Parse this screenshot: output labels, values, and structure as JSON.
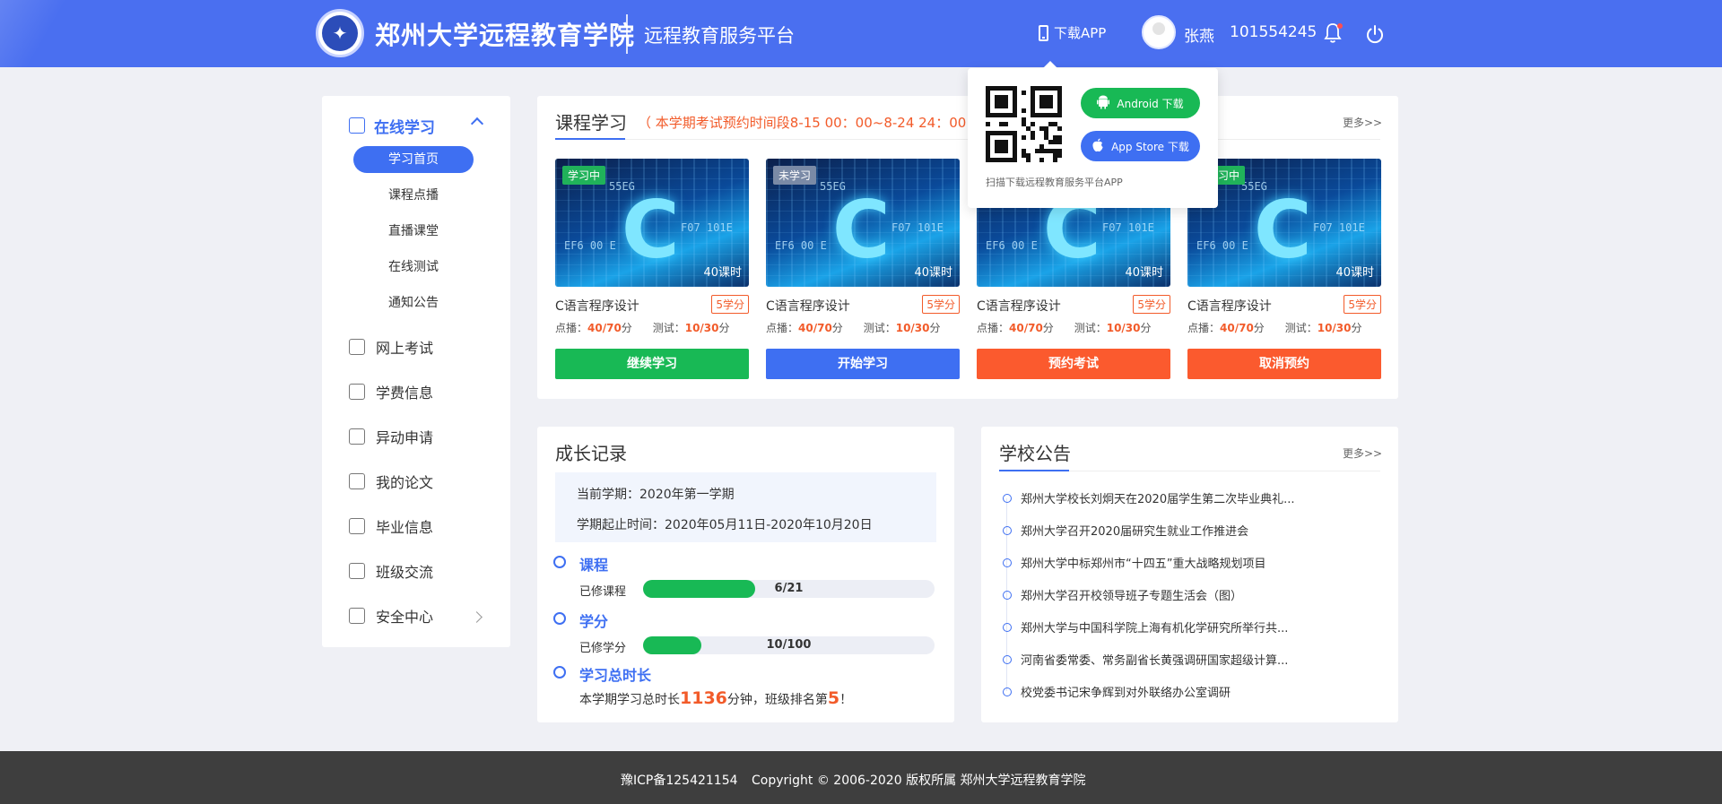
{
  "header": {
    "brand": "郑州大学远程教育学院",
    "platform": "远程教育服务平台",
    "download_app": "下载APP",
    "user_name": "张燕",
    "user_id": "101554245",
    "colors": {
      "header_bg": "#4a6ff0",
      "accent": "#3e6ff2",
      "green": "#18b955",
      "orange": "#fb5a2e",
      "red_text": "#f25b2a"
    }
  },
  "sidebar": {
    "section": "在线学习",
    "subitems": [
      "学习首页",
      "课程点播",
      "直播课堂",
      "在线测试",
      "通知公告"
    ],
    "items": [
      "网上考试",
      "学费信息",
      "异动申请",
      "我的论文",
      "毕业信息",
      "班级交流",
      "安全中心"
    ]
  },
  "course": {
    "title": "课程学习",
    "exam_notice": "（ 本学期考试预约时间段8-15 00：00~8-24 24：00 ）",
    "more": "更多>>",
    "cards": [
      {
        "badge": "学习中",
        "hours": "40课时",
        "name": "C语言程序设计",
        "credit": "5学分",
        "play_label": "点播：",
        "play": "40/70",
        "test_label": "测试：",
        "test": "10/30",
        "unit": "分",
        "button": "继续学习"
      },
      {
        "badge": "未学习",
        "hours": "40课时",
        "name": "C语言程序设计",
        "credit": "5学分",
        "play_label": "点播：",
        "play": "40/70",
        "test_label": "测试：",
        "test": "10/30",
        "unit": "分",
        "button": "开始学习"
      },
      {
        "badge": "",
        "hours": "40课时",
        "name": "C语言程序设计",
        "credit": "5学分",
        "play_label": "点播：",
        "play": "40/70",
        "test_label": "测试：",
        "test": "10/30",
        "unit": "分",
        "button": "预约考试"
      },
      {
        "badge": "习中",
        "hours": "40课时",
        "name": "C语言程序设计",
        "credit": "5学分",
        "play_label": "点播：",
        "play": "40/70",
        "test_label": "测试：",
        "test": "10/30",
        "unit": "分",
        "button": "取消预约"
      }
    ]
  },
  "popup": {
    "android": "Android 下载",
    "appstore": "App Store 下载",
    "caption": "扫描下载远程教育服务平台APP"
  },
  "growth": {
    "title": "成长记录",
    "term": "当前学期：2020年第一学期",
    "period": "学期起止时间：2020年05月11日-2020年10月20日",
    "course_title": "课程",
    "course_label": "已修课程",
    "course_progress": "6/21",
    "course_fraction": 0.3857,
    "credit_title": "学分",
    "credit_label": "已修学分",
    "credit_progress": "10/100",
    "credit_fraction": 0.2,
    "time_title": "学习总时长",
    "time_prefix": "本学期学习总时长",
    "time_value": "1136",
    "time_middle": "分钟，班级排名第",
    "rank_value": "5",
    "time_suffix": "！"
  },
  "announce": {
    "title": "学校公告",
    "more": "更多>>",
    "items": [
      "郑州大学校长刘炯天在2020届学生第二次毕业典礼...",
      "郑州大学召开2020届研究生就业工作推进会",
      "郑州大学中标郑州市“十四五”重大战略规划项目",
      "郑州大学召开校领导班子专题生活会（图）",
      "郑州大学与中国科学院上海有机化学研究所举行共...",
      "河南省委常委、常务副省长黄强调研国家超级计算...",
      "校党委书记宋争辉到对外联络办公室调研"
    ]
  },
  "footer": {
    "icp": "豫ICP备125421154",
    "copyright": "Copyright © 2006-2020 版权所属 郑州大学远程教育学院"
  }
}
